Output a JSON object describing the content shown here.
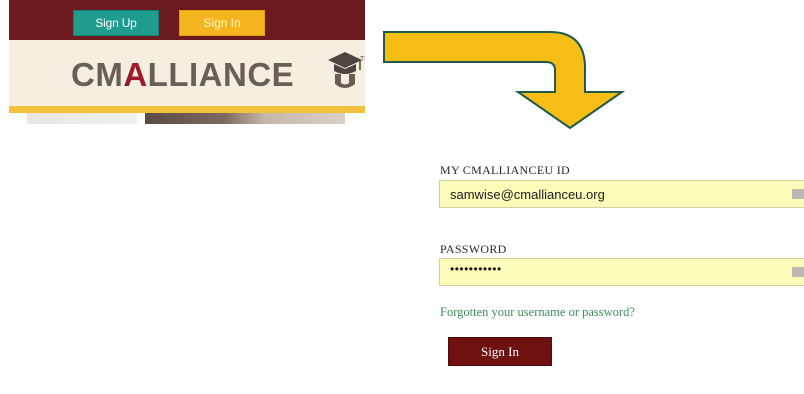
{
  "site": {
    "signup_label": "Sign Up",
    "signin_label": "Sign In",
    "logo_text_prefix": "CM",
    "logo_text_a": "A",
    "logo_text_rest": "LLIANCE",
    "logo_text_u": "U",
    "logo_tm": "TM"
  },
  "login": {
    "id_label": "MY CMALLIANCEU ID",
    "id_value": "samwise@cmallianceu.org",
    "password_label": "PASSWORD",
    "password_value": "•••••••••••",
    "forgot_link": "Forgotten your username or password?",
    "signin_button": "Sign In"
  },
  "colors": {
    "maroon": "#6b1a1f",
    "teal": "#1f9c8e",
    "gold": "#f5b51e",
    "arrow": "#f6bd14",
    "input_bg": "#fbfcb9",
    "link": "#3f8e5d",
    "button": "#6f1111"
  },
  "icons": {
    "arrow": "curved-down-arrow-icon",
    "cap": "graduation-cap-icon",
    "field": "keyboard-icon"
  }
}
